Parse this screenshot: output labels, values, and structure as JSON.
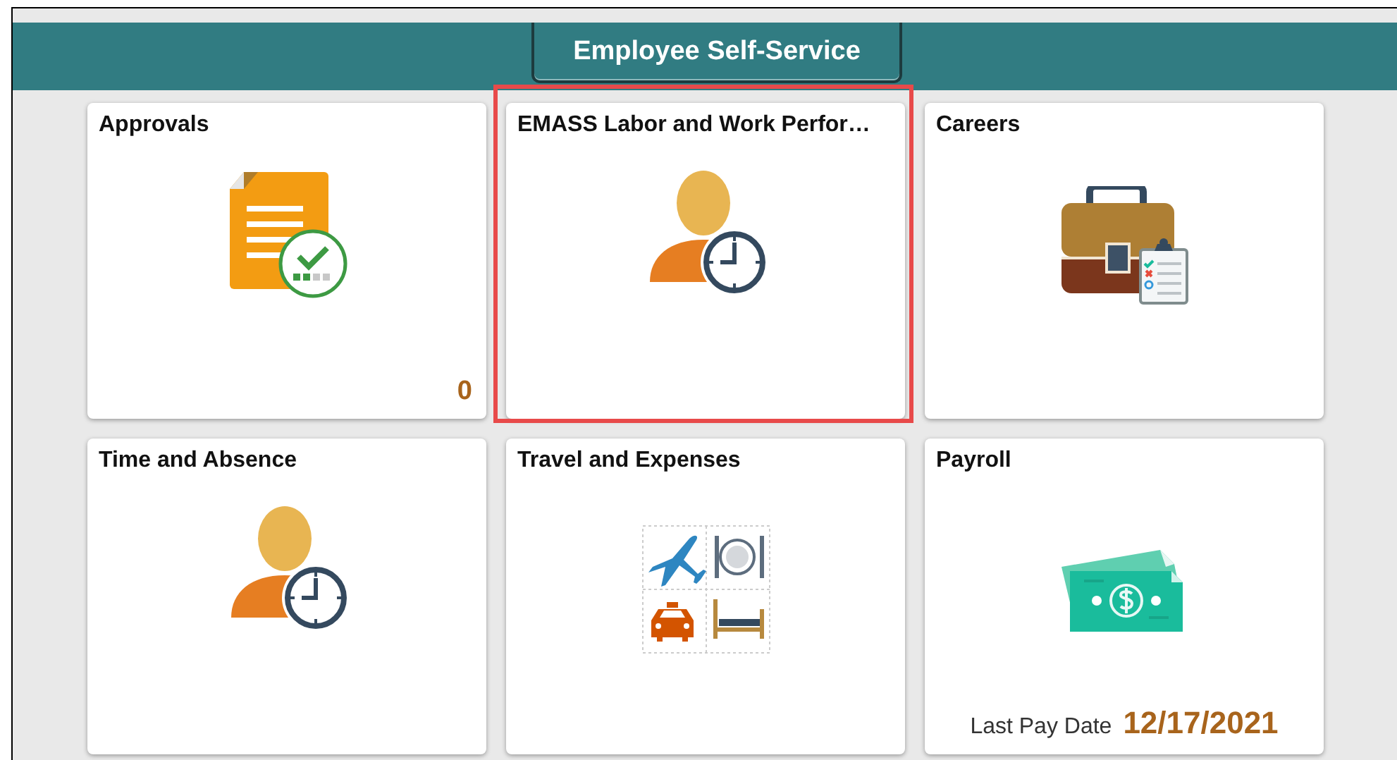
{
  "header": {
    "title": "Employee Self-Service"
  },
  "tiles": [
    {
      "title": "Approvals",
      "kind": "approvals",
      "highlighted": false,
      "count": "0"
    },
    {
      "title": "EMASS Labor and Work Perfor…",
      "kind": "timer",
      "highlighted": true
    },
    {
      "title": "Careers",
      "kind": "careers",
      "highlighted": false
    },
    {
      "title": "Time and Absence",
      "kind": "timer",
      "highlighted": false
    },
    {
      "title": "Travel and Expenses",
      "kind": "travel",
      "highlighted": false
    },
    {
      "title": "Payroll",
      "kind": "payroll",
      "highlighted": false,
      "footer_label": "Last Pay Date",
      "footer_value": "12/17/2021"
    }
  ]
}
